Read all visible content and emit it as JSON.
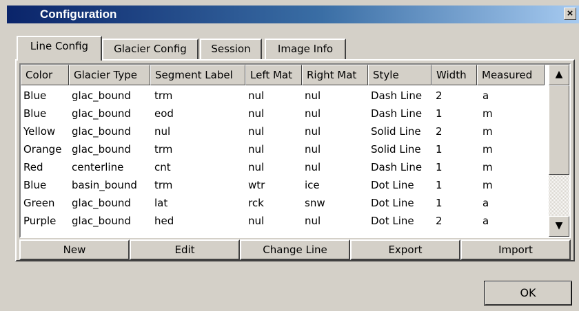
{
  "window": {
    "title": "Configuration",
    "close_label": "×"
  },
  "tabs": [
    {
      "label": "Line Config",
      "active": true
    },
    {
      "label": "Glacier Config",
      "active": false
    },
    {
      "label": "Session",
      "active": false
    },
    {
      "label": "Image Info",
      "active": false
    }
  ],
  "table": {
    "columns": [
      "Color",
      "Glacier Type",
      "Segment Label",
      "Left Mat",
      "Right Mat",
      "Style",
      "Width",
      "Measured"
    ],
    "rows": [
      [
        "Blue",
        "glac_bound",
        "trm",
        "nul",
        "nul",
        "Dash Line",
        "2",
        "a"
      ],
      [
        "Blue",
        "glac_bound",
        "eod",
        "nul",
        "nul",
        "Dash Line",
        "1",
        "m"
      ],
      [
        "Yellow",
        "glac_bound",
        "nul",
        "nul",
        "nul",
        "Solid Line",
        "2",
        "m"
      ],
      [
        "Orange",
        "glac_bound",
        "trm",
        "nul",
        "nul",
        "Solid Line",
        "1",
        "m"
      ],
      [
        "Red",
        "centerline",
        "cnt",
        "nul",
        "nul",
        "Dash Line",
        "1",
        "m"
      ],
      [
        "Blue",
        "basin_bound",
        "trm",
        "wtr",
        "ice",
        "Dot Line",
        "1",
        "m"
      ],
      [
        "Green",
        "glac_bound",
        "lat",
        "rck",
        "snw",
        "Dot Line",
        "1",
        "a"
      ],
      [
        "Purple",
        "glac_bound",
        "hed",
        "nul",
        "nul",
        "Dot Line",
        "2",
        "a"
      ]
    ],
    "scroll_up": "▲",
    "scroll_down": "▼"
  },
  "actions": [
    "New",
    "Edit",
    "Change Line",
    "Export",
    "Import"
  ],
  "ok_label": "OK",
  "colors": {
    "title_start": "#0a246a",
    "title_end": "#a6caf0",
    "face": "#d4d0c8"
  }
}
